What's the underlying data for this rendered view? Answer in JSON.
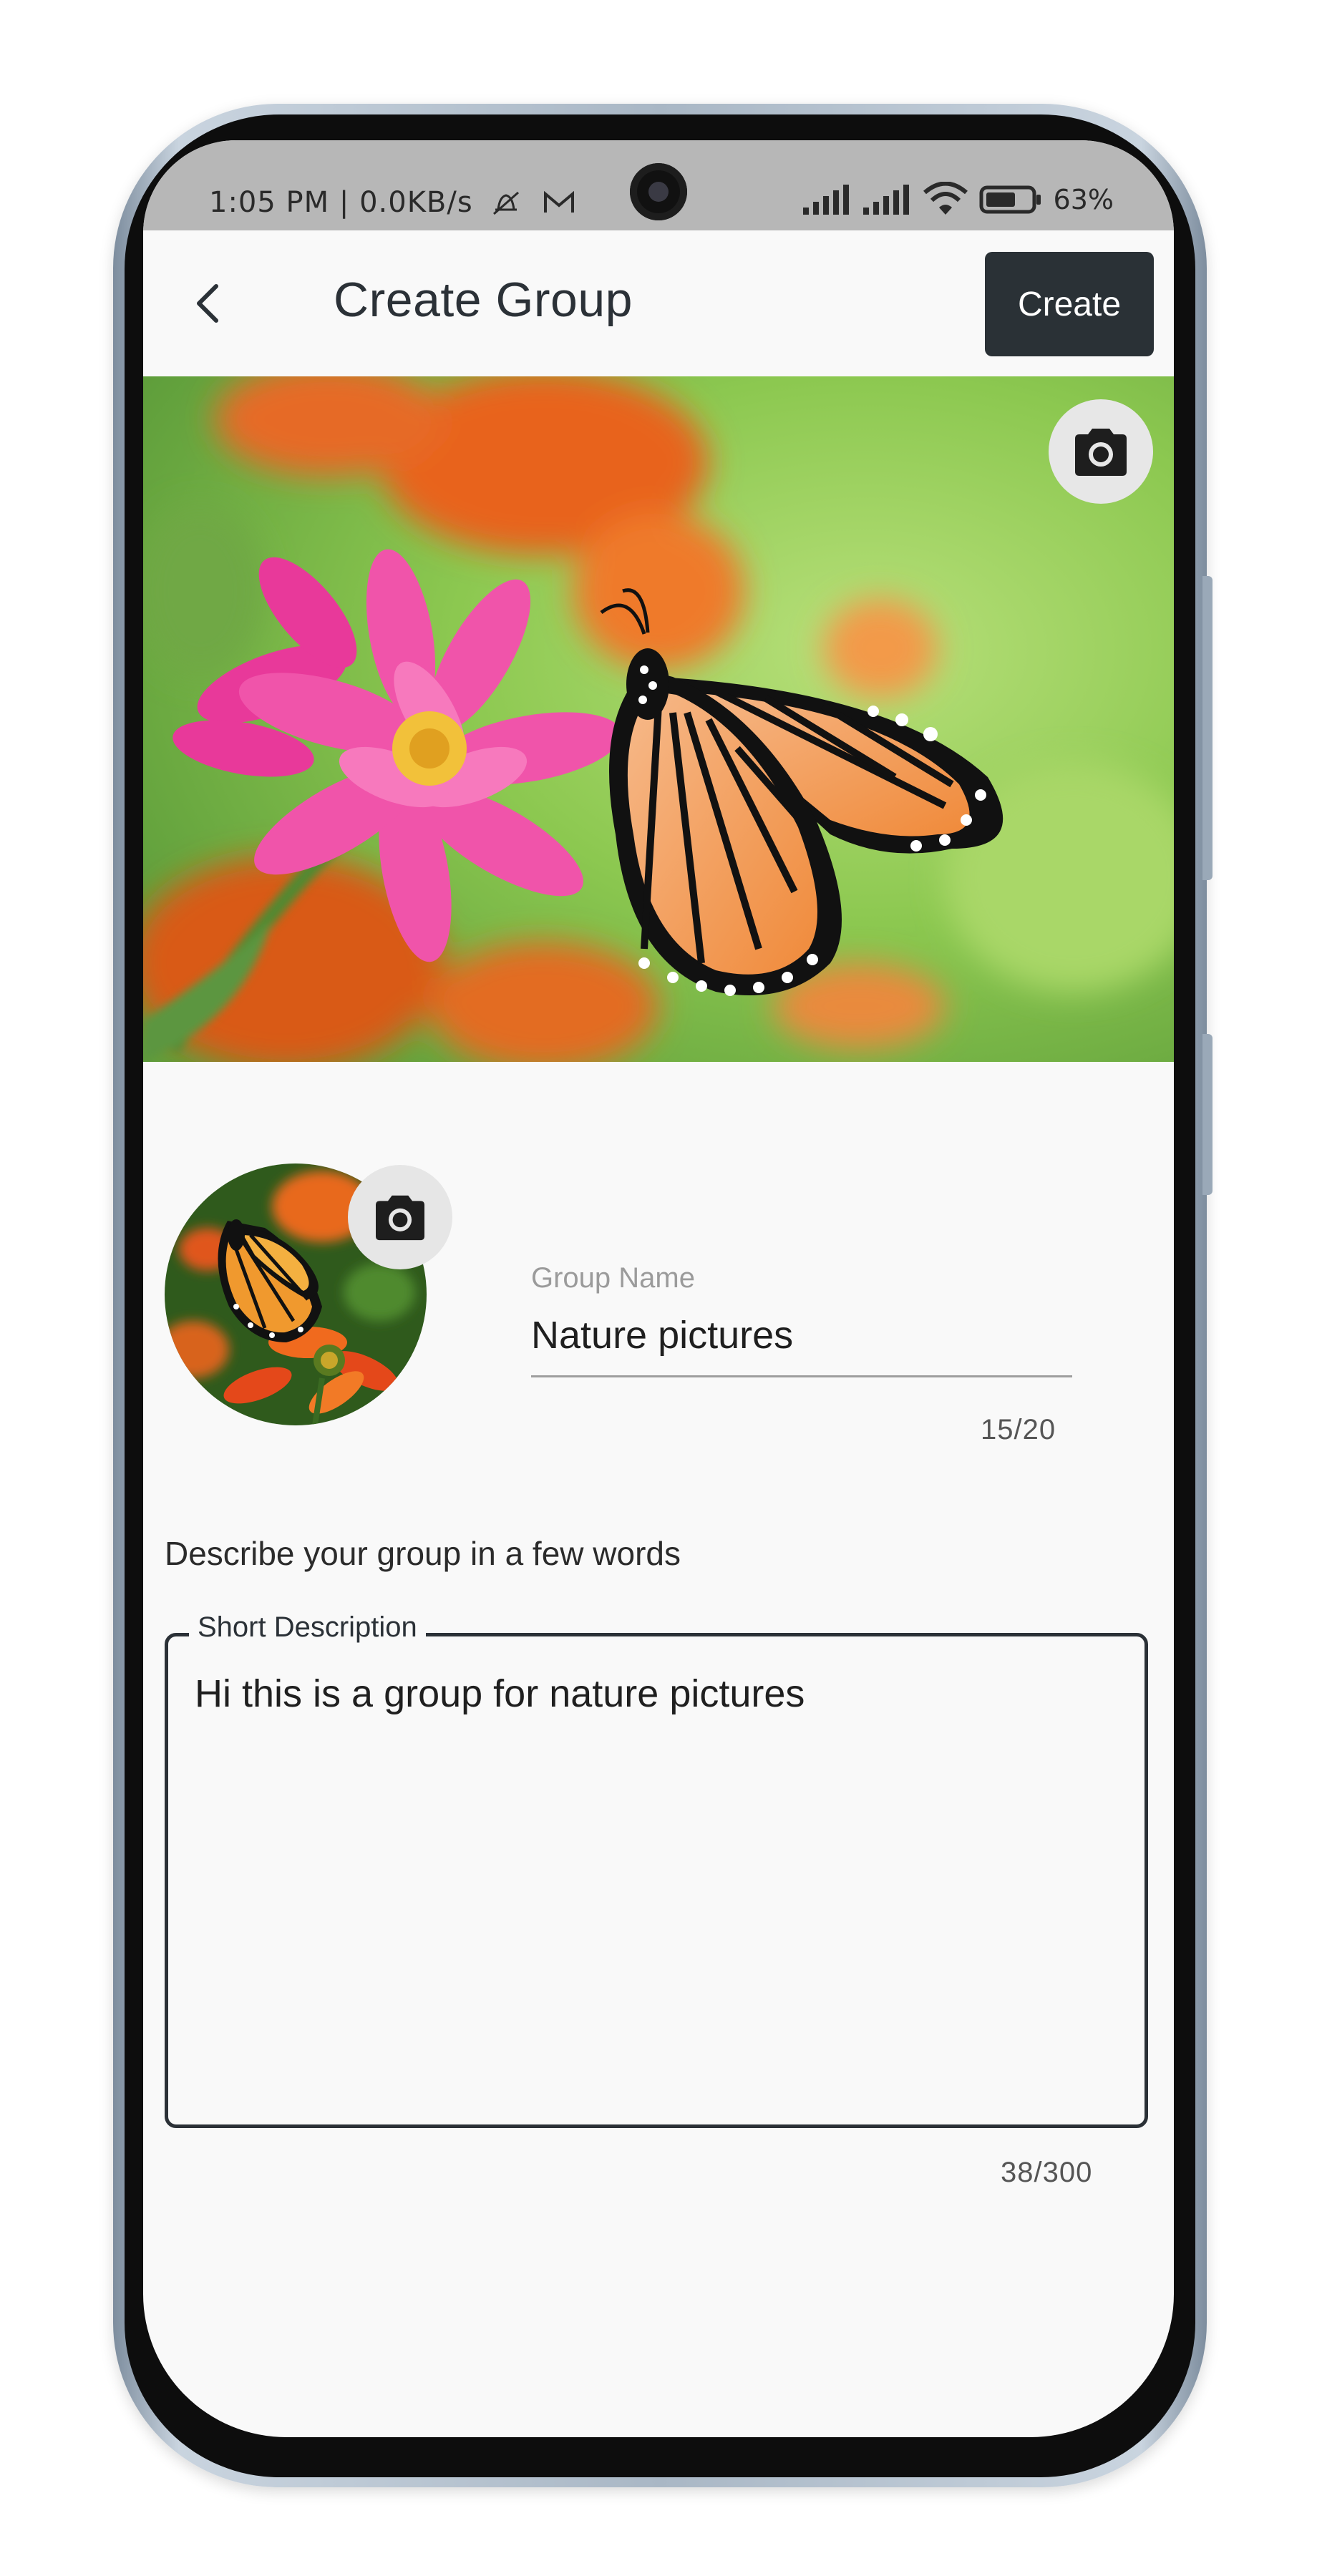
{
  "status_bar": {
    "time": "1:05 PM",
    "speed": "0.0KB/s",
    "battery_percent": "63%",
    "icons": [
      "muted-bell-icon",
      "mail-icon",
      "signal-icon",
      "signal-icon",
      "wifi-icon",
      "battery-icon"
    ]
  },
  "app_bar": {
    "title": "Create Group",
    "back_icon": "chevron-left-icon",
    "create_label": "Create"
  },
  "cover": {
    "image": "butterfly-on-pink-flower",
    "camera_icon": "camera-icon"
  },
  "avatar": {
    "image": "butterfly-on-orange-flowers",
    "camera_icon": "camera-icon"
  },
  "group_name": {
    "label": "Group Name",
    "value": "Nature pictures",
    "counter": "15/20"
  },
  "description": {
    "prompt": "Describe your group in a few words",
    "label": "Short Description",
    "value": "Hi this is a group for nature pictures",
    "counter": "38/300"
  },
  "colors": {
    "primary_dark": "#2a3136",
    "background": "#f9f9f9",
    "status_bar": "#b7b7b7"
  }
}
